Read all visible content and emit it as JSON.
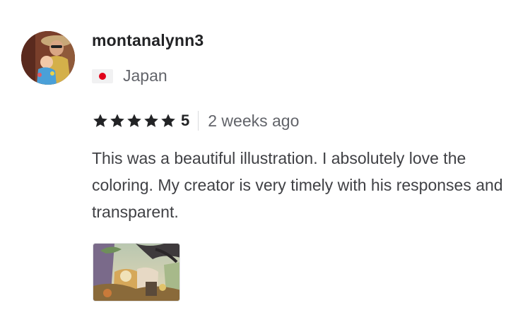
{
  "reviewer": {
    "username": "montanalynn3",
    "country": "Japan",
    "avatar_icon": "user-avatar-photo",
    "flag_icon": "japan-flag-icon"
  },
  "rating": {
    "stars": 5,
    "value": "5",
    "time_ago": "2 weeks ago",
    "star_color": "#222325"
  },
  "review": {
    "text": "This was a beautiful illustration. I absolutely love the coloring. My creator is very timely with his responses and transparent."
  },
  "attachment": {
    "icon": "illustration-thumbnail"
  }
}
